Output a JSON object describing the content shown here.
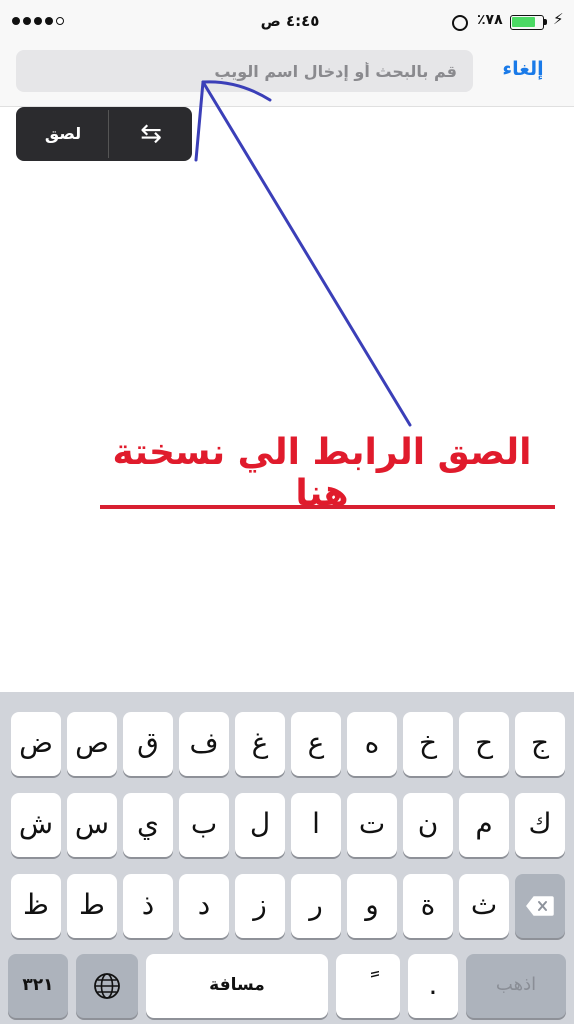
{
  "status_bar": {
    "signal_dots": 5,
    "time": "٤:٤٥ ص",
    "battery_percent_label": "٪٧٨",
    "battery_level": 0.78,
    "charging_icon": "bolt-icon",
    "alarm_icon": "alarm-clock-icon"
  },
  "address_bar": {
    "placeholder": "قم بالبحث أو إدخال اسم الويب",
    "value": "",
    "cancel_label": "إلغاء"
  },
  "edit_menu": {
    "paste_label": "لصق",
    "swap_icon": "swap-arrows-icon"
  },
  "annotation": {
    "text": "الصق الرابط الي نسختة هنا",
    "arrow_color": "#3b3fb8",
    "text_color": "#e01b2c"
  },
  "keyboard": {
    "rows": [
      [
        "ج",
        "ح",
        "خ",
        "ه",
        "ع",
        "غ",
        "ف",
        "ق",
        "ص",
        "ض"
      ],
      [
        "ك",
        "م",
        "ن",
        "ت",
        "ا",
        "ل",
        "ب",
        "ي",
        "س",
        "ش"
      ],
      [
        "ث",
        "ة",
        "و",
        "ر",
        "ز",
        "د",
        "ذ",
        "ط",
        "ظ"
      ]
    ],
    "backspace_icon": "backspace-icon",
    "numbers_label": "٣٢١",
    "globe_icon": "globe-icon",
    "space_label": "مسافة",
    "diacritic_label": "ً",
    "period_label": ".",
    "go_label": "اذهب"
  }
}
